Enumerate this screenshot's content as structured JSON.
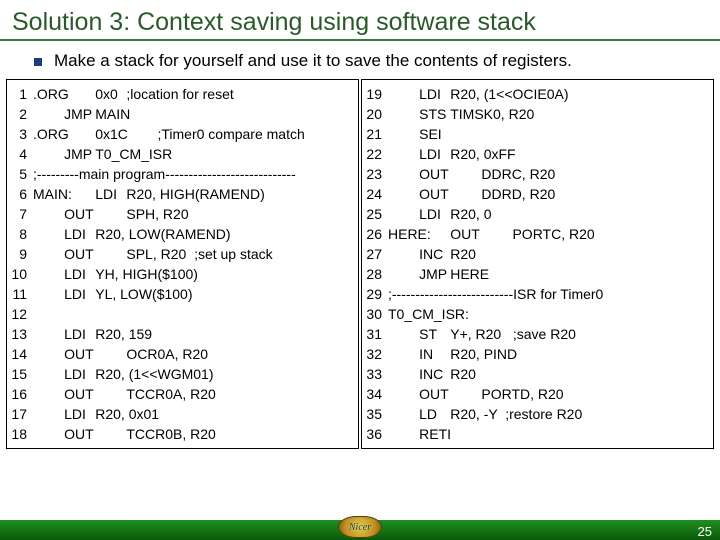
{
  "title": "Solution 3: Context saving using software stack",
  "bullet": "Make a stack for yourself and use it to save the contents of registers.",
  "code_left": ".ORG\t0x0\t;location for reset\n\tJMP\tMAIN\n.ORG\t0x1C\t;Timer0 compare match\n\tJMP\tT0_CM_ISR\n;---------main program----------------------------\nMAIN:\tLDI\tR20, HIGH(RAMEND)\n\tOUT\tSPH, R20\n\tLDI\tR20, LOW(RAMEND)\n\tOUT\tSPL, R20  ;set up stack\n\tLDI\tYH, HIGH($100)\n\tLDI\tYL, LOW($100)\n\n\tLDI\tR20, 159\n\tOUT\tOCR0A, R20\n\tLDI\tR20, (1<<WGM01)\n\tOUT\tTCCR0A, R20\n\tLDI\tR20, 0x01\n\tOUT\tTCCR0B, R20",
  "code_right": "\tLDI\tR20, (1<<OCIE0A)\n\tSTS\tTIMSK0, R20\n\tSEI\n\tLDI\tR20, 0xFF\n\tOUT\tDDRC, R20\n\tOUT\tDDRD, R20\n\tLDI\tR20, 0\nHERE:\tOUT\tPORTC, R20\n\tINC\tR20\n\tJMP\tHERE\n;--------------------------ISR for Timer0\nT0_CM_ISR:\n\tST\tY+, R20   ;save R20\n\tIN\tR20, PIND\n\tINC\tR20\n\tOUT\tPORTD, R20\n\tLD\tR20, -Y  ;restore R20\n\tRETI",
  "lines_left": "1\n2\n3\n4\n5\n6\n7\n8\n9\n10\n11\n12\n13\n14\n15\n16\n17\n18",
  "lines_right": "19\n20\n21\n22\n23\n24\n25\n26\n27\n28\n29\n30\n31\n32\n33\n34\n35\n36",
  "page_number": "25",
  "logo_text": "Nicer"
}
